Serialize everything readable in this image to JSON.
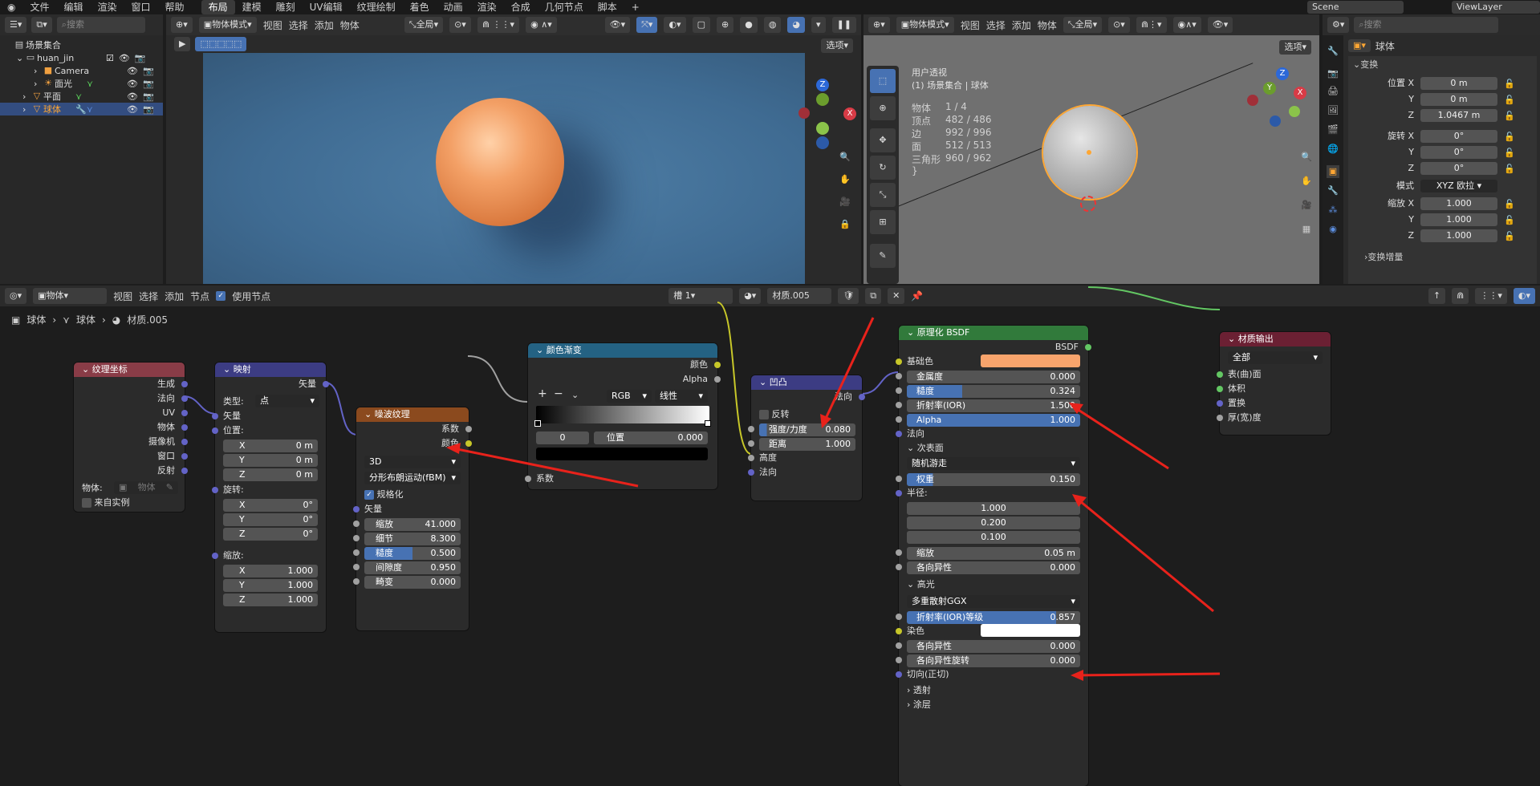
{
  "menu": {
    "logo": "blender-icon",
    "items": [
      "文件",
      "编辑",
      "渲染",
      "窗口",
      "帮助"
    ],
    "workspaces": [
      "布局",
      "建模",
      "雕刻",
      "UV编辑",
      "纹理绘制",
      "着色",
      "动画",
      "渲染",
      "合成",
      "几何节点",
      "脚本"
    ],
    "active_workspace": "布局",
    "add": "+",
    "scene": "Scene",
    "view_layer": "ViewLayer"
  },
  "outliner": {
    "search_placeholder": "搜索",
    "rows": [
      {
        "label": "场景集合",
        "indent": 0
      },
      {
        "label": "huan_jin",
        "indent": 1
      },
      {
        "label": "Camera",
        "indent": 2
      },
      {
        "label": "面光",
        "indent": 2
      },
      {
        "label": "平面",
        "indent": 1
      },
      {
        "label": "球体",
        "indent": 1,
        "selected": true
      }
    ]
  },
  "viewport_left": {
    "mode": "物体模式",
    "menus": [
      "视图",
      "选择",
      "添加",
      "物体"
    ],
    "transform": "全局",
    "options": "选项",
    "gizmo": {
      "x": "X",
      "y": "Y",
      "z": "Z"
    }
  },
  "viewport_right": {
    "mode": "物体模式",
    "menus": [
      "视图",
      "选择",
      "添加",
      "物体"
    ],
    "transform": "全局",
    "options": "选项",
    "info_title": "用户透视",
    "info_sub": "(1) 场景集合 | 球体",
    "stats": [
      {
        "k": "物体",
        "v": "1 / 4"
      },
      {
        "k": "顶点",
        "v": "482 / 486"
      },
      {
        "k": "边",
        "v": "992 / 996"
      },
      {
        "k": "面",
        "v": "512 / 513"
      },
      {
        "k": "三角形",
        "v": "960 / 962"
      }
    ],
    "gizmo": {
      "x": "X",
      "y": "Y",
      "z": "Z"
    }
  },
  "properties": {
    "search_placeholder": "搜索",
    "object_name": "球体",
    "section": "变换",
    "location_label": "位置 X",
    "location": [
      "0 m",
      "0 m",
      "1.0467 m"
    ],
    "rotation_label": "旋转 X",
    "rotation": [
      "0°",
      "0°",
      "0°"
    ],
    "mode_label": "模式",
    "mode_value": "XYZ 欧拉",
    "scale_label": "缩放 X",
    "scale": [
      "1.000",
      "1.000",
      "1.000"
    ],
    "axis_y": "Y",
    "axis_z": "Z",
    "delta": "变换增量"
  },
  "node_editor": {
    "type": "物体",
    "menus": [
      "视图",
      "选择",
      "添加",
      "节点"
    ],
    "use_nodes": "使用节点",
    "slot": "槽 1",
    "material": "材质.005",
    "breadcrumb": [
      "球体",
      "球体",
      "材质.005"
    ]
  },
  "nodes": {
    "texcoord": {
      "title": "纹理坐标",
      "outputs": [
        "生成",
        "法向",
        "UV",
        "物体",
        "摄像机",
        "窗口",
        "反射"
      ],
      "object_label": "物体:",
      "object_placeholder": "物体",
      "from_instancer": "来自实例"
    },
    "mapping": {
      "title": "映射",
      "out": "矢量",
      "type_label": "类型:",
      "type_value": "点",
      "in_vector": "矢量",
      "location": "位置:",
      "loc": [
        "0 m",
        "0 m",
        "0 m"
      ],
      "rotation": "旋转:",
      "rot": [
        "0°",
        "0°",
        "0°"
      ],
      "scale": "缩放:",
      "scl": [
        "1.000",
        "1.000",
        "1.000"
      ],
      "x": "X",
      "y": "Y",
      "z": "Z"
    },
    "noise": {
      "title": "噪波纹理",
      "out_fac": "系数",
      "out_color": "颜色",
      "dim": "3D",
      "type": "分形布朗运动(fBM)",
      "normalize": "规格化",
      "in_vector": "矢量",
      "params": [
        {
          "k": "缩放",
          "v": "41.000"
        },
        {
          "k": "细节",
          "v": "8.300"
        },
        {
          "k": "糙度",
          "v": "0.500"
        },
        {
          "k": "间隙度",
          "v": "0.950"
        },
        {
          "k": "畸变",
          "v": "0.000"
        }
      ]
    },
    "ramp": {
      "title": "颜色渐变",
      "out_color": "颜色",
      "out_alpha": "Alpha",
      "plus": "+",
      "minus": "−",
      "mode": "RGB",
      "interp": "线性",
      "stop_index": "0",
      "pos_label": "位置",
      "pos_value": "0.000",
      "in_fac": "系数"
    },
    "bump": {
      "title": "凹凸",
      "out_normal": "法向",
      "invert": "反转",
      "strength_k": "强度/力度",
      "strength_v": "0.080",
      "distance_k": "距离",
      "distance_v": "1.000",
      "height": "高度",
      "normal": "法向"
    },
    "bsdf": {
      "title": "原理化 BSDF",
      "out": "BSDF",
      "base_color": "基础色",
      "base_color_hex": "#f8a46c",
      "metallic_k": "金属度",
      "metallic_v": "0.000",
      "rough_k": "糙度",
      "rough_v": "0.324",
      "ior_k": "折射率(IOR)",
      "ior_v": "1.500",
      "alpha_k": "Alpha",
      "alpha_v": "1.000",
      "normal": "法向",
      "subsurface": "次表面",
      "sss_method": "随机游走",
      "weight_k": "权重",
      "weight_v": "0.150",
      "radius": "半径:",
      "radius_vals": [
        "1.000",
        "0.200",
        "0.100"
      ],
      "sss_scale_k": "缩放",
      "sss_scale_v": "0.05 m",
      "aniso_k": "各向异性",
      "aniso_v": "0.000",
      "specular": "高光",
      "spec_dist": "多重散射GGX",
      "ior_level_k": "折射率(IOR)等级",
      "ior_level_v": "0.857",
      "tint": "染色",
      "spec_aniso_k": "各向异性",
      "spec_aniso_v": "0.000",
      "spec_rot_k": "各向异性旋转",
      "spec_rot_v": "0.000",
      "tangent": "切向(正切)",
      "transmission": "透射",
      "coat": "涂层"
    },
    "output": {
      "title": "材质输出",
      "target": "全部",
      "inputs": [
        "表(曲)面",
        "体积",
        "置换",
        "厚(宽)度"
      ]
    }
  },
  "colors": {
    "accent": "#4772b3",
    "annotation": "#e8221b",
    "selected_orange": "#ffa733"
  }
}
